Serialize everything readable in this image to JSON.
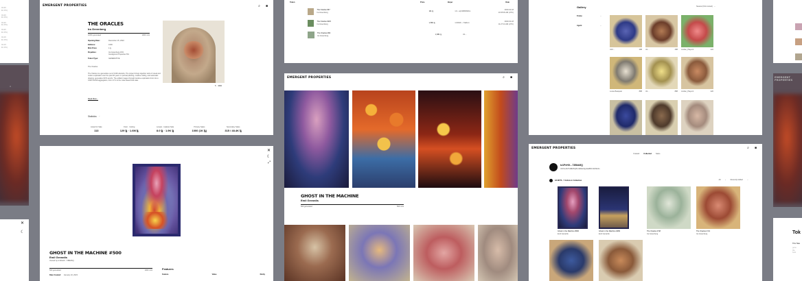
{
  "brand": "EMERGENT PROPERTIES",
  "oracles": {
    "title": "THE ORACLES",
    "artist": "Ira Greenberg",
    "progress_label": "100% generated",
    "progress_count": "1000 mint",
    "fields": [
      {
        "k": "Opening Date:",
        "v": "December 15, 2022"
      },
      {
        "k": "Editions:",
        "v": "1000"
      },
      {
        "k": "Mint Price:",
        "v": "1 ꜩ"
      },
      {
        "k": "Royalties:",
        "v": "Ira Greenberg 10%\nGoodgrove Properties 5%"
      },
      {
        "k": "Token Type:",
        "v": "GENERATIVE"
      }
    ],
    "lede": "The Oracles",
    "body": "The Oracles is a generative set of 1000 artworks. The project brings together tools of visual and motion exploration over the past 30 years: in portrait painting, creative coding, and automatic drawing, generative NFTs and AI. The artifact images through iterative exploration from ink to CNFT/GANN aggregation, from GT 2 to the code-based final state.",
    "read_more": "Read More...",
    "image_count": "4162",
    "statistics": "Statistics",
    "stats": [
      {
        "k": "Listed for Sale",
        "v": "113"
      },
      {
        "k": "Floor · Ceiling",
        "v": "129 ꜩ · 1.6M ꜩ"
      },
      {
        "k": "Lowest · Highest Sale",
        "v": "8.0 ꜩ · 1.9K ꜩ"
      },
      {
        "k": "Primary Sales",
        "v": "1000 (1K ꜩ)"
      },
      {
        "k": "Secondary Sales",
        "v": "315 / 48.4K ꜩ"
      }
    ]
  },
  "table": {
    "headers": [
      "Token",
      "Price",
      "Buyer",
      "Date"
    ],
    "rows": [
      {
        "name": "The Oracles #67",
        "by": "Ira Greenberg",
        "price": "111 ꜩ",
        "buyer": "tz1...sqCdNMWAhs",
        "date": "2023-01-18\n10:35:36 AM (UTC)"
      },
      {
        "name": "The Oracles #115",
        "by": "Ira Greenberg",
        "price": "1,581 ꜩ",
        "buyer": "tz1K6zb...7JaRvm",
        "date": "2023-01-18\n11:27:13 AM (UTC)"
      },
      {
        "name": "The Oracles #93",
        "by": "Ira Greenberg",
        "price": "1,581 ꜩ",
        "buyer": "tz1...",
        "date": ""
      }
    ]
  },
  "gallery": {
    "title": "Gallery",
    "sort": "Newest (First Listed)",
    "filters": [
      "Frame",
      "Agent"
    ],
    "items": [
      {
        "owner": "tz1K...",
        "price": "288"
      },
      {
        "owner": "tz1...",
        "price": "288"
      },
      {
        "owner": "Jordan_Player1",
        "price": "222"
      },
      {
        "owner": "Lucas Basquiat",
        "price": "888"
      },
      {
        "owner": "tz1...",
        "price": "888"
      },
      {
        "owner": "Jordan_Player1",
        "price": "220"
      },
      {
        "owner": "",
        "price": ""
      },
      {
        "owner": "",
        "price": ""
      },
      {
        "owner": "",
        "price": ""
      }
    ]
  },
  "ghost_detail": {
    "title": "GHOST IN THE MACHINE #500",
    "artist": "Emil Gerardis",
    "owner": "Owned by tz1PeHX...73Bkb5Q",
    "progress_label": "500 generated",
    "progress_count": "1000 mint",
    "date_label": "Date Created:",
    "date_value": "January 24, 2023",
    "features": "Features",
    "feature_cols": [
      "Feature",
      "Value",
      "Rarity"
    ]
  },
  "ghost_collection": {
    "title": "GHOST IN THE MACHINE",
    "artist": "Emil Gerardis",
    "progress_label": "500 generated",
    "progress_count": "500 mint"
  },
  "profile": {
    "tabs": [
      "Created",
      "Collected",
      "Sales"
    ],
    "name": "tz1PeHX...73Bkb5Q",
    "address": "tz1PeHXZ7aBkb5Q8nzdDkH0qp4ak8R1XH69AFx",
    "collection": "18 NFTS · 7 Artists in Collection",
    "filter_all": "All",
    "filter_sort": "Recently Added",
    "items": [
      {
        "name": "Ghost in the Machine #500",
        "by": "Emil Gerardis"
      },
      {
        "name": "Ghost in the Machine #483",
        "by": "Emil Gerardis"
      },
      {
        "name": "The Oracles # 68",
        "by": "Ira Greenberg"
      },
      {
        "name": "The Oracles # 19",
        "by": "Ira Greenberg"
      }
    ]
  },
  "token_panel": {
    "title": "Tok",
    "body": "This Toke"
  },
  "colors": {
    "background": "#7a7c85",
    "accent": "#111111"
  }
}
